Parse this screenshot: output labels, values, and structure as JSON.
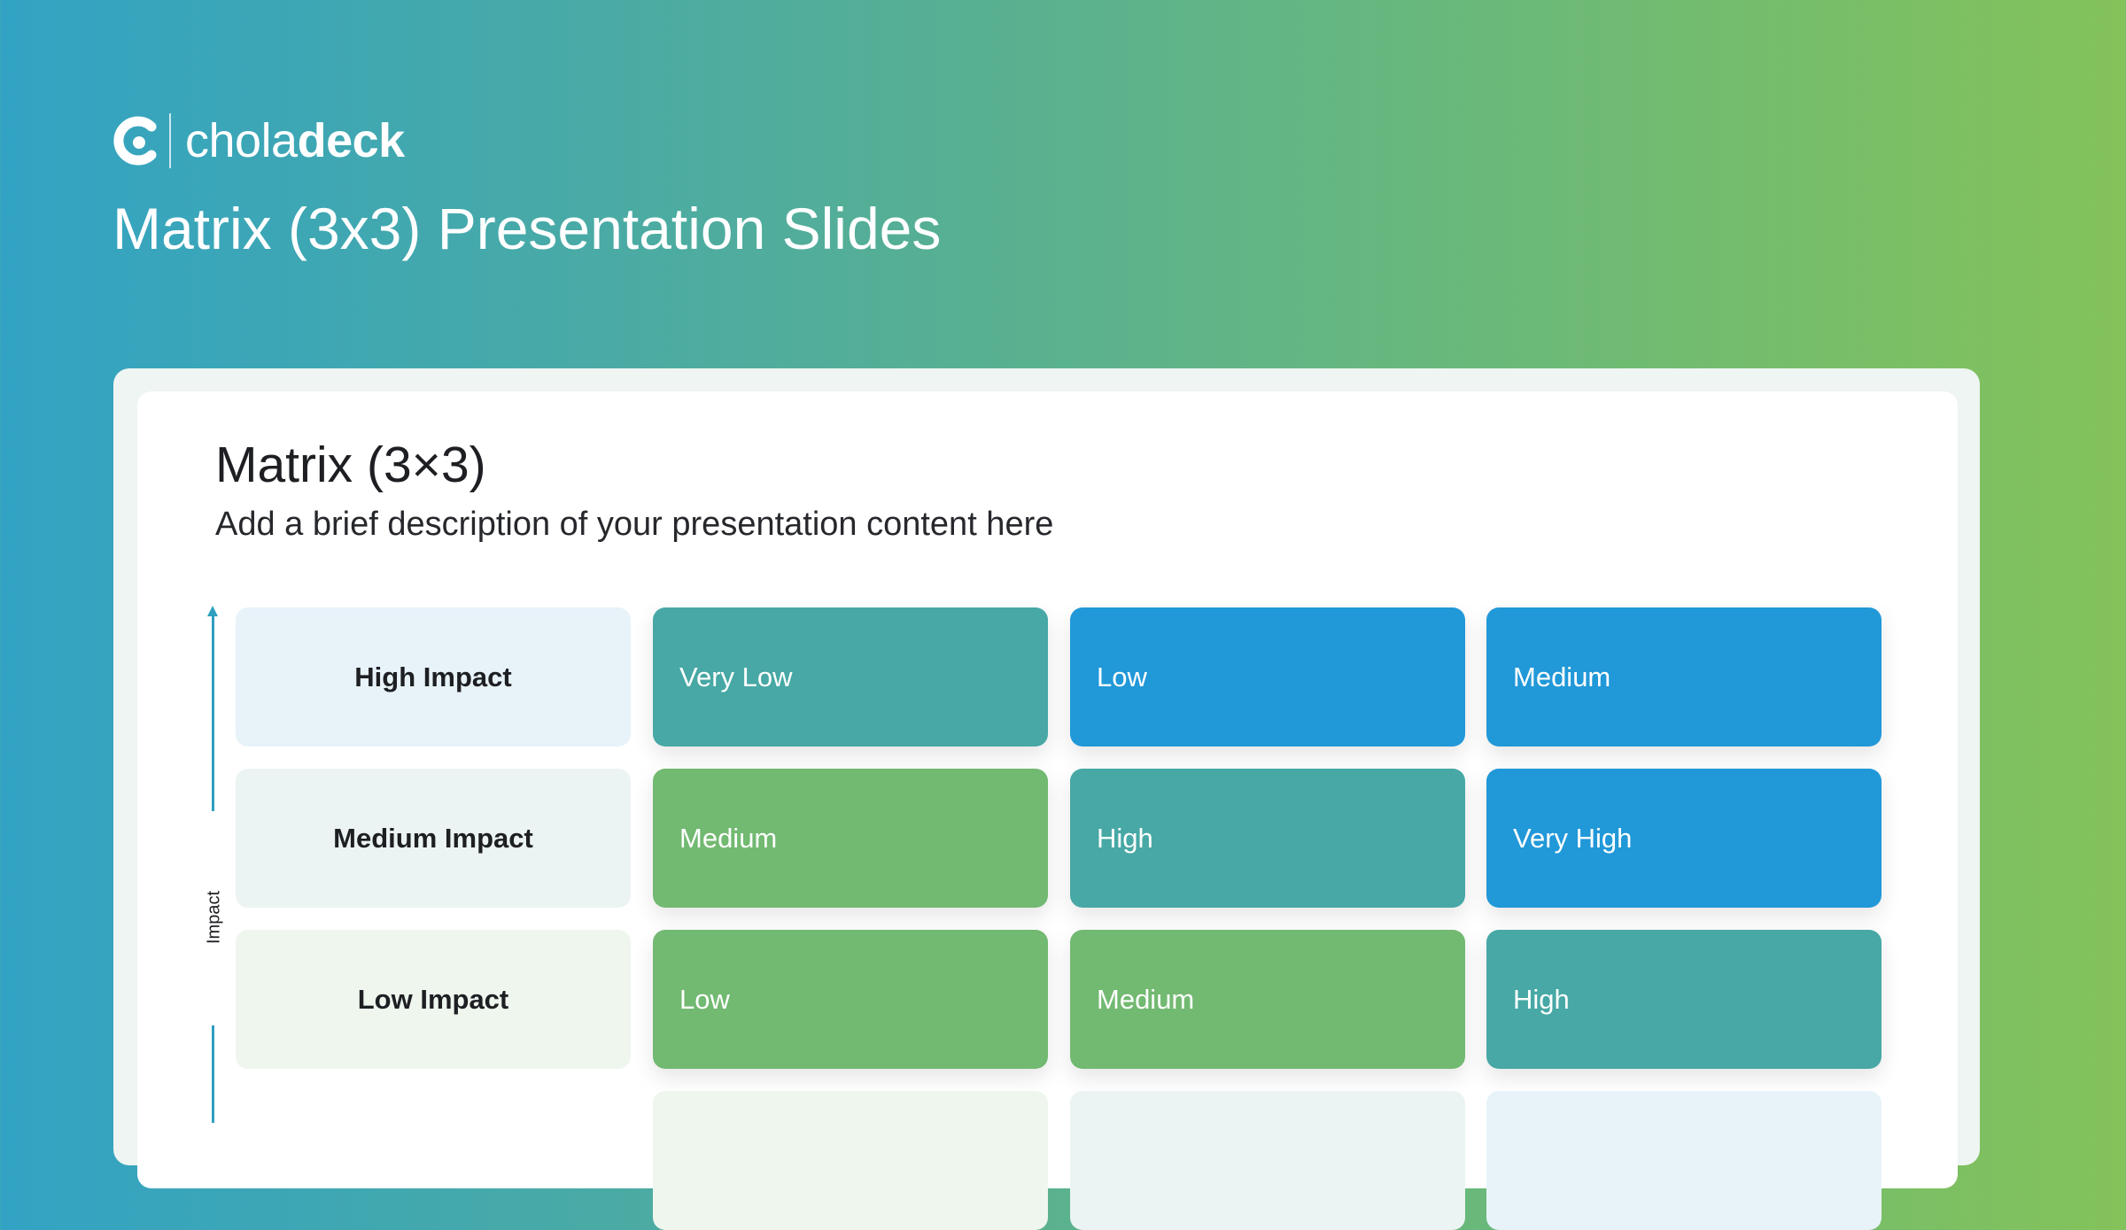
{
  "brand": {
    "name_light": "chola",
    "name_bold": "deck",
    "logo_icon": "cholaldeck-c-logo"
  },
  "hero": {
    "title": "Matrix (3x3) Presentation Slides"
  },
  "slide": {
    "title": "Matrix (3×3)",
    "description": "Add a brief description of your presentation content here",
    "axis_label": "Impact",
    "rows": [
      {
        "label": "High Impact",
        "cells": [
          {
            "text": "Very Low",
            "color": "#47a8a5"
          },
          {
            "text": "Low",
            "color": "#2198d8"
          },
          {
            "text": "Medium",
            "color": "#2198d8"
          }
        ]
      },
      {
        "label": "Medium Impact",
        "cells": [
          {
            "text": "Medium",
            "color": "#72b971"
          },
          {
            "text": "High",
            "color": "#47a8a5"
          },
          {
            "text": "Very High",
            "color": "#2198d8"
          }
        ]
      },
      {
        "label": "Low Impact",
        "cells": [
          {
            "text": "Low",
            "color": "#72b971"
          },
          {
            "text": "Medium",
            "color": "#72b971"
          },
          {
            "text": "High",
            "color": "#47a8a5"
          }
        ]
      }
    ]
  },
  "colors": {
    "teal": "#47a8a5",
    "blue": "#2198d8",
    "green": "#72b971",
    "axis": "#2f9fc0"
  }
}
